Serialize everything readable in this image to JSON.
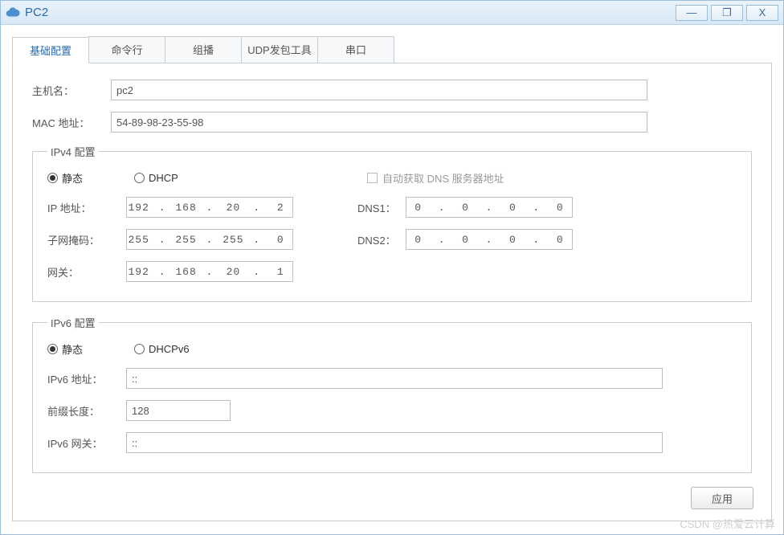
{
  "window": {
    "title": "PC2",
    "buttons": {
      "min": "—",
      "max": "❐",
      "close": "X"
    }
  },
  "tabs": [
    {
      "label": "基础配置",
      "active": true
    },
    {
      "label": "命令行",
      "active": false
    },
    {
      "label": "组播",
      "active": false
    },
    {
      "label": "UDP发包工具",
      "active": false
    },
    {
      "label": "串口",
      "active": false
    }
  ],
  "basic": {
    "hostname_label": "主机名：",
    "hostname_value": "pc2",
    "mac_label": "MAC 地址：",
    "mac_value": "54-89-98-23-55-98"
  },
  "ipv4": {
    "legend": "IPv4 配置",
    "mode_static": "静态",
    "mode_dhcp": "DHCP",
    "auto_dns_label": "自动获取 DNS 服务器地址",
    "ip_label": "IP 地址：",
    "ip": [
      "192",
      "168",
      "20",
      "2"
    ],
    "mask_label": "子网掩码：",
    "mask": [
      "255",
      "255",
      "255",
      "0"
    ],
    "gw_label": "网关：",
    "gw": [
      "192",
      "168",
      "20",
      "1"
    ],
    "dns1_label": "DNS1：",
    "dns1": [
      "0",
      "0",
      "0",
      "0"
    ],
    "dns2_label": "DNS2：",
    "dns2": [
      "0",
      "0",
      "0",
      "0"
    ]
  },
  "ipv6": {
    "legend": "IPv6 配置",
    "mode_static": "静态",
    "mode_dhcp": "DHCPv6",
    "addr_label": "IPv6 地址：",
    "addr_value": "::",
    "prefix_label": "前缀长度：",
    "prefix_value": "128",
    "gw_label": "IPv6 网关：",
    "gw_value": "::"
  },
  "apply_label": "应用",
  "watermark": "CSDN @热爱云计算"
}
